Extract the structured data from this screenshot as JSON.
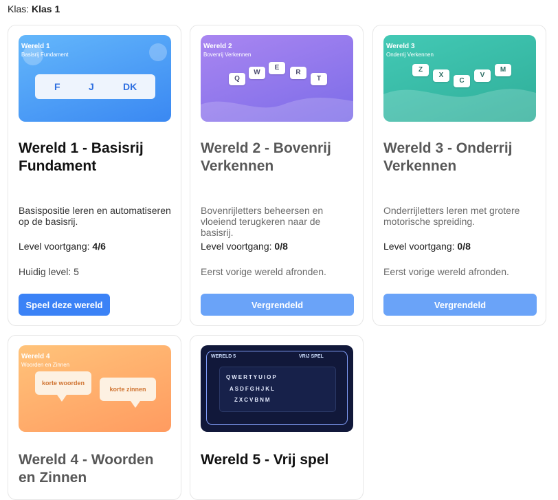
{
  "header": {
    "klas_label": "Klas:",
    "klas_value": "Klas 1"
  },
  "worlds": [
    {
      "thumb_name": "Wereld 1",
      "thumb_sub": "Basisrij Fundament",
      "keys": [
        "F",
        "J",
        "DK"
      ],
      "title": "Wereld 1 - Basisrij Fundament",
      "desc": "Basispositie leren en automatiseren op de basisrij.",
      "progress_label": "Level voortgang:",
      "progress_value": "4/6",
      "info": "Huidig level: 5",
      "button": "Speel deze wereld"
    },
    {
      "thumb_name": "Wereld 2",
      "thumb_sub": "Bovenrij Verkennen",
      "keys": [
        "Q",
        "W",
        "E",
        "R",
        "T"
      ],
      "title": "Wereld 2 - Bovenrij Verkennen",
      "desc": "Bovenrijletters beheersen en vloeiend terugkeren naar de basisrij.",
      "progress_label": "Level voortgang:",
      "progress_value": "0/8",
      "info": "Eerst vorige wereld afronden.",
      "button": "Vergrendeld"
    },
    {
      "thumb_name": "Wereld 3",
      "thumb_sub": "Onderrij Verkennen",
      "keys": [
        "Z",
        "X",
        "C",
        "V",
        "M"
      ],
      "title": "Wereld 3 - Onderrij Verkennen",
      "desc": "Onderrijletters leren met grotere motorische spreiding.",
      "progress_label": "Level voortgang:",
      "progress_value": "0/8",
      "info": "Eerst vorige wereld afronden.",
      "button": "Vergrendeld"
    },
    {
      "thumb_name": "Wereld 4",
      "thumb_sub": "Woorden en Zinnen",
      "bubbles": [
        "korte woorden",
        "korte zinnen"
      ],
      "title": "Wereld 4 - Woorden en Zinnen"
    },
    {
      "thumb_left": "WERELD 5",
      "thumb_right": "VRIJ SPEL",
      "rows": [
        "QWERTYUIOP",
        "ASDFGHJKL",
        "ZXCVBNM"
      ],
      "title": "Wereld 5 - Vrij spel"
    }
  ],
  "colors": {
    "primary_button": "#3b82f6",
    "locked_button": "#6aa3f8",
    "world1": "#3a88f2",
    "world2": "#7c6ce8",
    "world3": "#2fae99",
    "world4": "#ff9b60",
    "world5": "#11183a"
  }
}
